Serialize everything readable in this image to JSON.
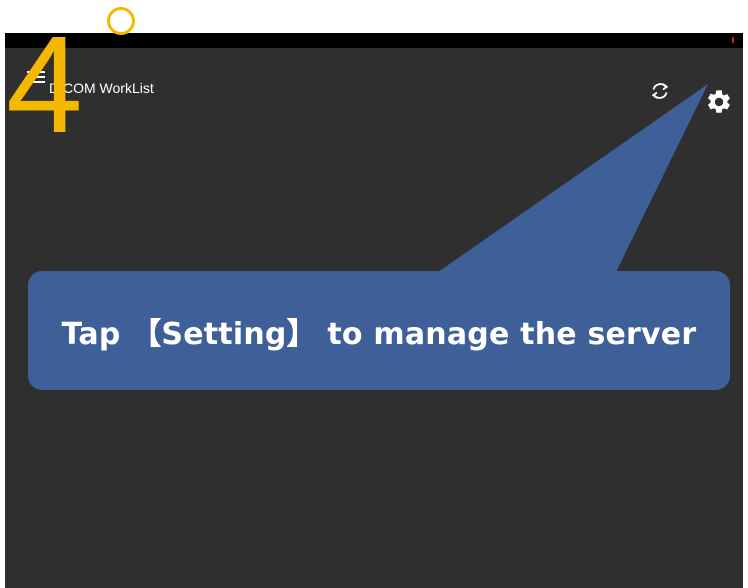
{
  "app": {
    "title": "DICOM WorkList"
  },
  "toolbar": {
    "menu_icon": "hamburger-menu-icon",
    "refresh_icon": "refresh-icon",
    "settings_icon": "gear-icon"
  },
  "tutorial": {
    "step_number": "4",
    "step_mark": "°",
    "callout_text": "Tap 【Setting】 to manage the server"
  },
  "colors": {
    "screen_background": "#2f2f2f",
    "status_strip": "#000000",
    "callout": "#3f5f98",
    "step_number": "#f5b800"
  }
}
